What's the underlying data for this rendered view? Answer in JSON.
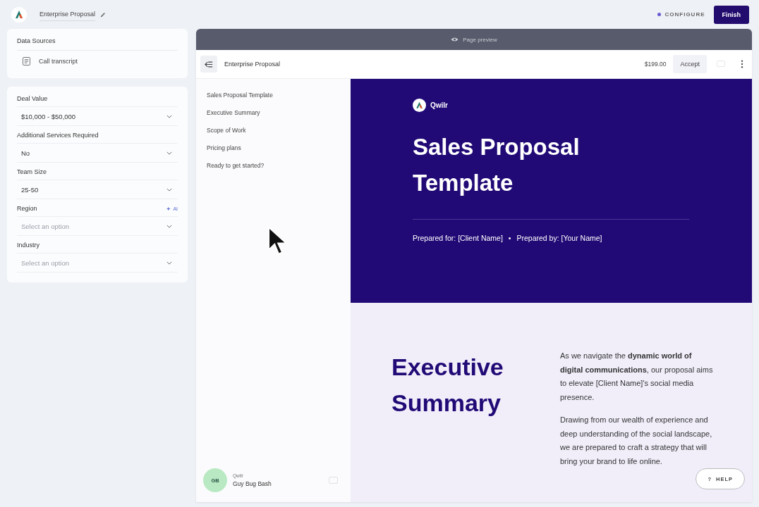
{
  "app": {
    "document_title": "Enterprise Proposal"
  },
  "status": {
    "label": "CONFIGURE"
  },
  "finish_button": "Finish",
  "data_sources": {
    "title": "Data Sources",
    "items": [
      "Call transcript"
    ]
  },
  "fields": [
    {
      "label": "Deal Value",
      "value": "$10,000 - $50,000"
    },
    {
      "label": "Additional Services Required",
      "value": "No"
    },
    {
      "label": "Team Size",
      "value": "25-50"
    },
    {
      "label": "Region",
      "placeholder": "Select an option",
      "ai_badge": "AI"
    },
    {
      "label": "Industry",
      "placeholder": "Select an option"
    }
  ],
  "preview": {
    "banner": "Page preview",
    "toolbar": {
      "title": "Enterprise Proposal",
      "price": "$199.00",
      "accept": "Accept"
    },
    "nav": [
      "Sales Proposal Template",
      "Executive Summary",
      "Scope of Work",
      "Pricing plans",
      "Ready to get started?"
    ],
    "user": {
      "initials": "GB",
      "org": "Qwilr",
      "name": "Guy Bug Bash"
    },
    "hero": {
      "brand": "Qwilr",
      "title": "Sales Proposal Template",
      "prepared_for": "Prepared for: [Client Name]",
      "separator": "•",
      "prepared_by": "Prepared by: [Your Name]"
    },
    "summary": {
      "heading": "Executive Summary",
      "paragraphs": [
        "As we navigate the **dynamic world of digital communications**, our proposal aims to elevate [Client Name]'s social media presence.",
        "Drawing from our wealth of experience and deep understanding of the social landscape, we are prepared to craft a strategy that will bring your brand to life online."
      ]
    }
  },
  "help": {
    "mark": "?",
    "label": "HELP"
  }
}
